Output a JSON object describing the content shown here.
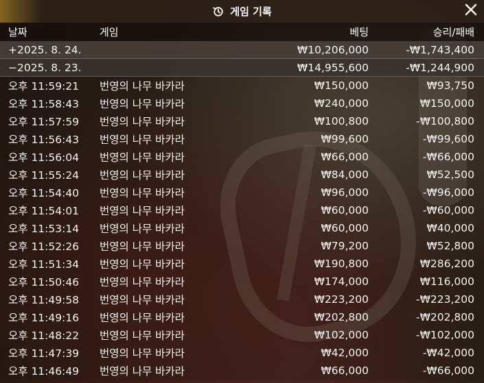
{
  "title": "게임 기록",
  "columns": {
    "date": "날짜",
    "game": "게임",
    "bet": "베팅",
    "result": "승리/패배"
  },
  "summaries": [
    {
      "date": "+2025. 8. 24.",
      "bet": "₩10,206,000",
      "result": "-₩1,743,400"
    },
    {
      "date": "−2025. 8. 23.",
      "bet": "₩14,955,600",
      "result": "-₩1,244,900"
    }
  ],
  "rows": [
    {
      "time": "오후 11:59:21",
      "game": "번영의 나무 바카라",
      "bet": "₩150,000",
      "result": "₩93,750"
    },
    {
      "time": "오후 11:58:43",
      "game": "번영의 나무 바카라",
      "bet": "₩240,000",
      "result": "₩150,000"
    },
    {
      "time": "오후 11:57:59",
      "game": "번영의 나무 바카라",
      "bet": "₩100,800",
      "result": "-₩100,800"
    },
    {
      "time": "오후 11:56:43",
      "game": "번영의 나무 바카라",
      "bet": "₩99,600",
      "result": "-₩99,600"
    },
    {
      "time": "오후 11:56:04",
      "game": "번영의 나무 바카라",
      "bet": "₩66,000",
      "result": "-₩66,000"
    },
    {
      "time": "오후 11:55:24",
      "game": "번영의 나무 바카라",
      "bet": "₩84,000",
      "result": "₩52,500"
    },
    {
      "time": "오후 11:54:40",
      "game": "번영의 나무 바카라",
      "bet": "₩96,000",
      "result": "-₩96,000"
    },
    {
      "time": "오후 11:54:01",
      "game": "번영의 나무 바카라",
      "bet": "₩60,000",
      "result": "-₩60,000"
    },
    {
      "time": "오후 11:53:14",
      "game": "번영의 나무 바카라",
      "bet": "₩60,000",
      "result": "₩40,000"
    },
    {
      "time": "오후 11:52:26",
      "game": "번영의 나무 바카라",
      "bet": "₩79,200",
      "result": "₩52,800"
    },
    {
      "time": "오후 11:51:34",
      "game": "번영의 나무 바카라",
      "bet": "₩190,800",
      "result": "₩286,200"
    },
    {
      "time": "오후 11:50:46",
      "game": "번영의 나무 바카라",
      "bet": "₩174,000",
      "result": "₩116,000"
    },
    {
      "time": "오후 11:49:58",
      "game": "번영의 나무 바카라",
      "bet": "₩223,200",
      "result": "-₩223,200"
    },
    {
      "time": "오후 11:49:16",
      "game": "번영의 나무 바카라",
      "bet": "₩202,800",
      "result": "-₩202,800"
    },
    {
      "time": "오후 11:48:22",
      "game": "번영의 나무 바카라",
      "bet": "₩102,000",
      "result": "-₩102,000"
    },
    {
      "time": "오후 11:47:39",
      "game": "번영의 나무 바카라",
      "bet": "₩42,000",
      "result": "-₩42,000"
    },
    {
      "time": "오후 11:46:49",
      "game": "번영의 나무 바카라",
      "bet": "₩66,000",
      "result": "-₩66,000"
    }
  ],
  "icons": {
    "title": "history-icon",
    "close": "close-icon"
  },
  "colors": {
    "titlebar": "#2d2018",
    "text": "#f5f5f5"
  }
}
